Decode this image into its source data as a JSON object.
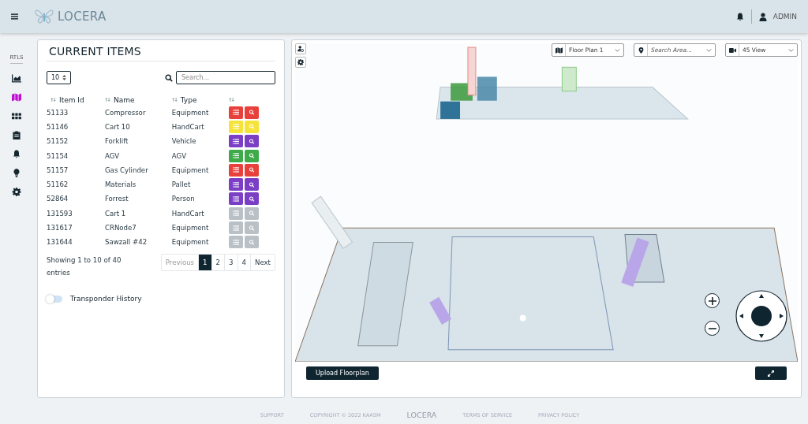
{
  "header": {
    "brand": "LOCERA",
    "user": "ADMIN"
  },
  "nav": {
    "section": "RTLS",
    "items": [
      {
        "kind": "chart",
        "selected": false
      },
      {
        "kind": "map",
        "selected": true
      },
      {
        "kind": "grid",
        "selected": false
      },
      {
        "kind": "clipboard",
        "selected": false
      },
      {
        "kind": "bell",
        "selected": false
      },
      {
        "kind": "bulb",
        "selected": false
      },
      {
        "kind": "gear",
        "selected": false
      }
    ]
  },
  "items_panel": {
    "title": "CURRENT ITEMS",
    "page_size": "10",
    "search": {
      "placeholder": "Search..."
    },
    "columns": [
      "Item Id",
      "Name",
      "Type"
    ],
    "rows": [
      {
        "id": "51133",
        "name": "Compressor",
        "type": "Equipment",
        "color": "#e8403a"
      },
      {
        "id": "51146",
        "name": "Cart 10",
        "type": "HandCart",
        "color": "#f5e33a"
      },
      {
        "id": "51152",
        "name": "Forklift",
        "type": "Vehicle",
        "color": "#7a3fc4"
      },
      {
        "id": "51154",
        "name": "AGV",
        "type": "AGV",
        "color": "#3eaa4a"
      },
      {
        "id": "51157",
        "name": "Gas Cylinder",
        "type": "Equipment",
        "color": "#e8403a"
      },
      {
        "id": "51162",
        "name": "Materials",
        "type": "Pallet",
        "color": "#7a3fc4"
      },
      {
        "id": "52864",
        "name": "Forrest",
        "type": "Person",
        "color": "#7a3fc4"
      },
      {
        "id": "131593",
        "name": "Cart 1",
        "type": "HandCart",
        "color": "#b9c0c6"
      },
      {
        "id": "131617",
        "name": "CRNode7",
        "type": "Equipment",
        "color": "#b9c0c6"
      },
      {
        "id": "131644",
        "name": "Sawzall #42",
        "type": "Equipment",
        "color": "#b9c0c6"
      }
    ],
    "info": "Showing 1 to 10 of 40 entries",
    "pager": {
      "previous": {
        "label": "Previous",
        "disabled": true
      },
      "pages": [
        {
          "label": "1",
          "selected": true
        },
        {
          "label": "2",
          "selected": false
        },
        {
          "label": "3",
          "selected": false
        },
        {
          "label": "4",
          "selected": false
        }
      ],
      "next": {
        "label": "Next",
        "disabled": false
      }
    },
    "toggle": {
      "label": "Transponder History",
      "on": false
    }
  },
  "map_panel": {
    "floor_plan": "Floor Plan 1",
    "area_search": {
      "placeholder": "Search Area..."
    },
    "view": "45 View",
    "upload_button": "Upload Floorplan"
  },
  "footer": {
    "links": [
      "SUPPORT",
      "COPYRIGHT © 2022 KAASM"
    ],
    "brand": "LOCERA",
    "links_right": [
      "TERMS OF SERVICE",
      "PRIVACY POLICY"
    ]
  }
}
